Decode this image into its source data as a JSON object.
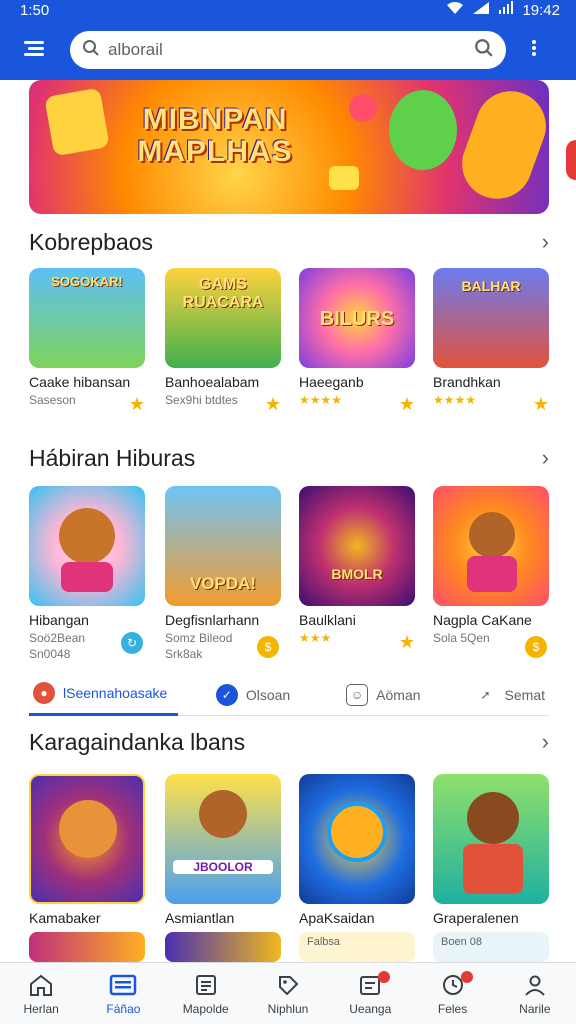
{
  "status": {
    "time_left": "1:50",
    "time_right": "19:42"
  },
  "search": {
    "value": "alborail",
    "placeholder": ""
  },
  "banner": {
    "title_line1": "MIBNPAN",
    "title_line2": "MAPLHAS"
  },
  "sections": [
    {
      "title": "Kobrepbaos",
      "cards": [
        {
          "name": "Caake hibansan",
          "sub": "Saseson",
          "thumb_text": "SOGOKAR!",
          "colors": [
            "#5cc0f5",
            "#7fd35a"
          ]
        },
        {
          "name": "Banhoealabam",
          "sub": "Sex9hi btdtes",
          "thumb_text": "GAMS RUACARA",
          "colors": [
            "#ffd23f",
            "#3fb04d"
          ]
        },
        {
          "name": "Haeeganb",
          "sub": "★★★★",
          "thumb_text": "BILURS",
          "colors": [
            "#ff6ea8",
            "#7b3fe0"
          ]
        },
        {
          "name": "Brandhkan",
          "sub": "★★★★",
          "thumb_text": "BALHAR",
          "colors": [
            "#6a7cf0",
            "#e2523b"
          ]
        }
      ]
    },
    {
      "title": "Hábiran Hiburas",
      "cards": [
        {
          "name": "Hibangan",
          "sub": "Soö2Bean",
          "sub2": "Sn0048",
          "thumb_text": "",
          "colors": [
            "#ffb6d5",
            "#35c2f0"
          ]
        },
        {
          "name": "Degfisnlarhann",
          "sub": "Somz Bileod",
          "sub2": "Srk8ak",
          "thumb_text": "VOPDA!",
          "colors": [
            "#6fc4f5",
            "#f39b2e"
          ]
        },
        {
          "name": "Baulklani",
          "sub": "★★★",
          "thumb_text": "BMOLR",
          "colors": [
            "#8a1fb0",
            "#f0b81f"
          ]
        },
        {
          "name": "Nagpla CaKane",
          "sub": "Sola 5Qen",
          "thumb_text": "",
          "colors": [
            "#ff8a1e",
            "#ff4d6a"
          ]
        }
      ]
    },
    {
      "title": "Karagaindanka lbans",
      "cards": [
        {
          "name": "Kamabaker",
          "thumb_text": "",
          "colors": [
            "#4a2fb0",
            "#ff9a1e"
          ]
        },
        {
          "name": "Asmiantlan",
          "thumb_text": "JBOOLOR",
          "colors": [
            "#ffe14a",
            "#4aa0f0"
          ]
        },
        {
          "name": "ApaKsaidan",
          "thumb_text": "",
          "colors": [
            "#1e6ee0",
            "#ffd23f"
          ]
        },
        {
          "name": "Graperalenen",
          "thumb_text": "",
          "colors": [
            "#8fe06a",
            "#1fb0a0"
          ]
        }
      ]
    }
  ],
  "chips": [
    {
      "label": "lSeennahoasake"
    },
    {
      "label": "Olsoan"
    },
    {
      "label": "Aöman"
    },
    {
      "label": "Semat"
    }
  ],
  "peek_row": [
    {
      "label": ""
    },
    {
      "label": ""
    },
    {
      "label": "Falbsa"
    },
    {
      "label": "Boen 08"
    }
  ],
  "nav": [
    {
      "label": "Herlan"
    },
    {
      "label": "Fáñao"
    },
    {
      "label": "Mapolde"
    },
    {
      "label": "Niphlun"
    },
    {
      "label": "Ueanga"
    },
    {
      "label": "Feles"
    },
    {
      "label": "Narile"
    }
  ],
  "colors": {
    "primary": "#1a56db",
    "star": "#f4b400",
    "badge": "#e53935"
  }
}
